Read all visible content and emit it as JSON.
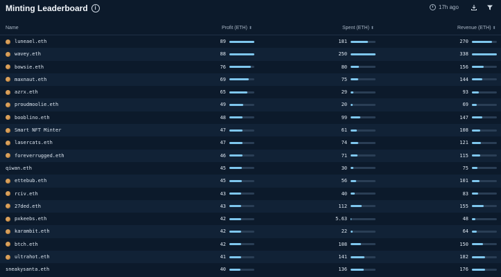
{
  "header": {
    "title": "Minting Leaderboard",
    "info_glyph": "i",
    "updated": "17h ago"
  },
  "columns": {
    "name": "Name",
    "profit": "Profit (ETH)",
    "spent": "Spent (ETH)",
    "revenue": "Revenue (ETH)",
    "sort_glyph": "⬍"
  },
  "colors": {
    "background": "#0c1a2b",
    "row_alt": "#112236",
    "bar": "#7fc7ee",
    "bar_track": "#2a3e55"
  },
  "rows": [
    {
      "name": "luneael.eth",
      "avatar": true,
      "profit": "89",
      "profit_pct": 1.0,
      "spent": "181",
      "spent_pct": 0.7,
      "revenue": "270",
      "revenue_pct": 0.8
    },
    {
      "name": "wavey.eth",
      "avatar": true,
      "profit": "88",
      "profit_pct": 0.99,
      "spent": "250",
      "spent_pct": 1.0,
      "revenue": "338",
      "revenue_pct": 1.0
    },
    {
      "name": "bowsie.eth",
      "avatar": true,
      "profit": "76",
      "profit_pct": 0.85,
      "spent": "80",
      "spent_pct": 0.32,
      "revenue": "156",
      "revenue_pct": 0.46
    },
    {
      "name": "maxnaut.eth",
      "avatar": true,
      "profit": "69",
      "profit_pct": 0.78,
      "spent": "75",
      "spent_pct": 0.3,
      "revenue": "144",
      "revenue_pct": 0.43
    },
    {
      "name": "azrx.eth",
      "avatar": true,
      "profit": "65",
      "profit_pct": 0.73,
      "spent": "29",
      "spent_pct": 0.12,
      "revenue": "93",
      "revenue_pct": 0.28
    },
    {
      "name": "proudmoolie.eth",
      "avatar": true,
      "profit": "49",
      "profit_pct": 0.55,
      "spent": "20",
      "spent_pct": 0.08,
      "revenue": "69",
      "revenue_pct": 0.2
    },
    {
      "name": "booblino.eth",
      "avatar": true,
      "profit": "48",
      "profit_pct": 0.54,
      "spent": "99",
      "spent_pct": 0.4,
      "revenue": "147",
      "revenue_pct": 0.43
    },
    {
      "name": "Smart NFT Minter",
      "avatar": true,
      "profit": "47",
      "profit_pct": 0.53,
      "spent": "61",
      "spent_pct": 0.24,
      "revenue": "108",
      "revenue_pct": 0.32
    },
    {
      "name": "lasercats.eth",
      "avatar": true,
      "profit": "47",
      "profit_pct": 0.53,
      "spent": "74",
      "spent_pct": 0.3,
      "revenue": "121",
      "revenue_pct": 0.36
    },
    {
      "name": "foreverrugged.eth",
      "avatar": true,
      "profit": "46",
      "profit_pct": 0.52,
      "spent": "71",
      "spent_pct": 0.28,
      "revenue": "115",
      "revenue_pct": 0.34
    },
    {
      "name": "qiwan.eth",
      "avatar": false,
      "profit": "45",
      "profit_pct": 0.51,
      "spent": "30",
      "spent_pct": 0.12,
      "revenue": "75",
      "revenue_pct": 0.22
    },
    {
      "name": "ettebub.eth",
      "avatar": true,
      "profit": "45",
      "profit_pct": 0.51,
      "spent": "56",
      "spent_pct": 0.22,
      "revenue": "101",
      "revenue_pct": 0.3
    },
    {
      "name": "rciv.eth",
      "avatar": true,
      "profit": "43",
      "profit_pct": 0.48,
      "spent": "40",
      "spent_pct": 0.16,
      "revenue": "83",
      "revenue_pct": 0.25
    },
    {
      "name": "27ded.eth",
      "avatar": true,
      "profit": "43",
      "profit_pct": 0.48,
      "spent": "112",
      "spent_pct": 0.45,
      "revenue": "155",
      "revenue_pct": 0.46
    },
    {
      "name": "pxkeebs.eth",
      "avatar": true,
      "profit": "42",
      "profit_pct": 0.47,
      "spent": "5.63",
      "spent_pct": 0.02,
      "revenue": "48",
      "revenue_pct": 0.14
    },
    {
      "name": "karambit.eth",
      "avatar": true,
      "profit": "42",
      "profit_pct": 0.47,
      "spent": "22",
      "spent_pct": 0.09,
      "revenue": "64",
      "revenue_pct": 0.19
    },
    {
      "name": "btch.eth",
      "avatar": true,
      "profit": "42",
      "profit_pct": 0.47,
      "spent": "108",
      "spent_pct": 0.43,
      "revenue": "150",
      "revenue_pct": 0.44
    },
    {
      "name": "ultrahot.eth",
      "avatar": true,
      "profit": "41",
      "profit_pct": 0.46,
      "spent": "141",
      "spent_pct": 0.56,
      "revenue": "182",
      "revenue_pct": 0.54
    },
    {
      "name": "sneakysanta.eth",
      "avatar": false,
      "profit": "40",
      "profit_pct": 0.45,
      "spent": "136",
      "spent_pct": 0.54,
      "revenue": "176",
      "revenue_pct": 0.52
    }
  ]
}
